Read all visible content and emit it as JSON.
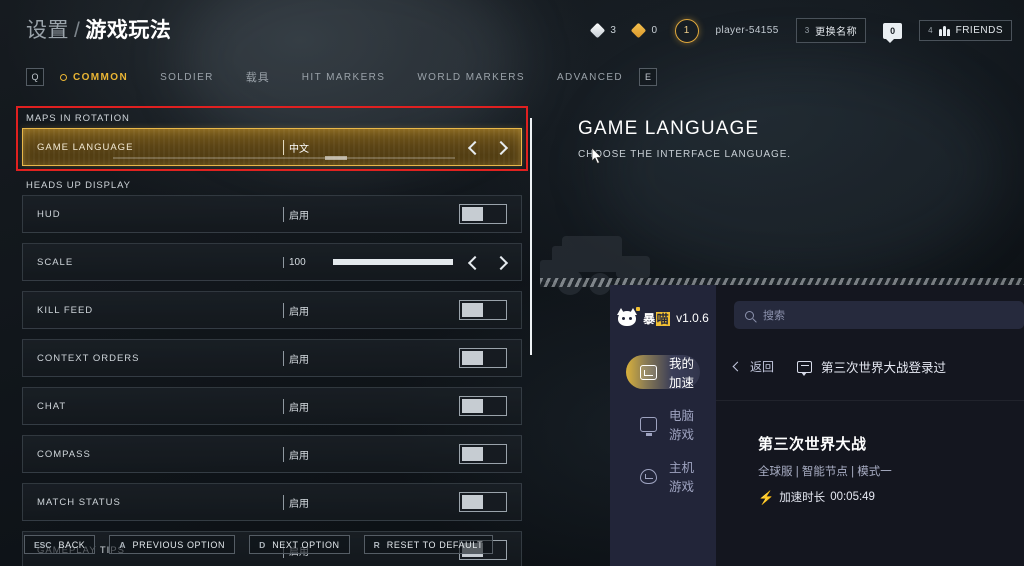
{
  "header": {
    "breadcrumb_parent": "设置",
    "breadcrumb_sep": "/",
    "breadcrumb_current": "游戏玩法"
  },
  "hud": {
    "currency_white": "3",
    "currency_gold": "0",
    "level": "1",
    "player_name": "player-54155",
    "rename_key": "3",
    "rename_label": "更换名称",
    "messages_count": "0",
    "friends_key": "4",
    "friends_label": "FRIENDS"
  },
  "tabs": {
    "left_key": "Q",
    "right_key": "E",
    "items": [
      {
        "label": "COMMON",
        "active": true
      },
      {
        "label": "SOLDIER",
        "active": false
      },
      {
        "label": "载具",
        "active": false
      },
      {
        "label": "HIT MARKERS",
        "active": false
      },
      {
        "label": "WORLD MARKERS",
        "active": false
      },
      {
        "label": "ADVANCED",
        "active": false
      }
    ]
  },
  "settings": {
    "group_1_label": "MAPS IN ROTATION",
    "group_2_label": "HEADS UP DISPLAY",
    "rows": [
      {
        "name": "GAME LANGUAGE",
        "value": "中文",
        "control": "stepper"
      },
      {
        "name": "HUD",
        "value": "启用",
        "control": "toggle"
      },
      {
        "name": "SCALE",
        "value": "100",
        "control": "slider",
        "fill_percent": 100
      },
      {
        "name": "KILL FEED",
        "value": "启用",
        "control": "toggle"
      },
      {
        "name": "CONTEXT ORDERS",
        "value": "启用",
        "control": "toggle"
      },
      {
        "name": "CHAT",
        "value": "启用",
        "control": "toggle"
      },
      {
        "name": "COMPASS",
        "value": "启用",
        "control": "toggle"
      },
      {
        "name": "MATCH STATUS",
        "value": "启用",
        "control": "toggle"
      },
      {
        "name": "GAMEPLAY TIPS",
        "value": "启用",
        "control": "toggle"
      }
    ]
  },
  "detail": {
    "title": "GAME LANGUAGE",
    "description": "CHOOSE THE INTERFACE LANGUAGE."
  },
  "footer": {
    "hints": [
      {
        "key": "ESC",
        "label": "BACK"
      },
      {
        "key": "A",
        "label": "PREVIOUS OPTION"
      },
      {
        "key": "D",
        "label": "NEXT OPTION"
      },
      {
        "key": "R",
        "label": "RESET TO DEFAULT"
      }
    ]
  },
  "booster": {
    "brand_prefix": "暴",
    "brand_highlight": "喵",
    "version": "v1.0.6",
    "nav": [
      {
        "label": "我的加速",
        "active": true
      },
      {
        "label": "电脑游戏",
        "active": false
      },
      {
        "label": "主机游戏",
        "active": false
      }
    ],
    "search_placeholder": "搜索",
    "back_label": "返回",
    "crumb_title": "第三次世界大战登录过",
    "game_title": "第三次世界大战",
    "game_meta": "全球服 | 智能节点 | 模式一",
    "speed_label": "加速时长",
    "speed_time": "00:05:49"
  },
  "colors": {
    "accent_gold": "#eab534",
    "highlight_border": "#e9b84a",
    "annotation_red": "#e02020",
    "booster_sidebar": "#222539"
  }
}
